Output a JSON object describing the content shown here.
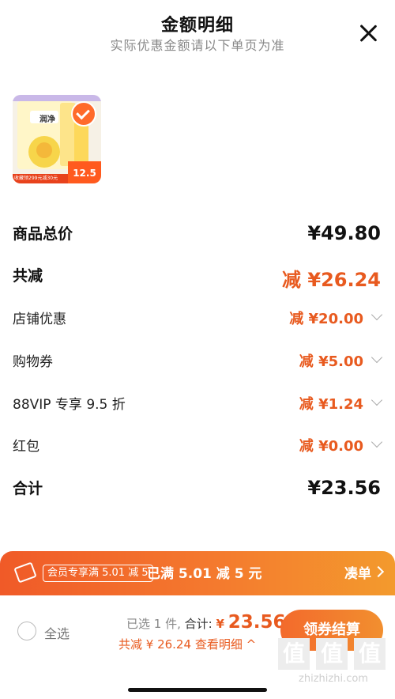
{
  "header": {
    "title": "金额明细",
    "subtitle": "实际优惠金额请以下单页为准"
  },
  "product": {
    "brand_text": "润净",
    "promo_line": "收藏领299元减30元",
    "price": "12.5"
  },
  "rows": [
    {
      "label": "商品总价",
      "value": "¥49.80"
    },
    {
      "label": "共减",
      "value": "减 ¥26.24"
    },
    {
      "label": "店铺优惠",
      "value": "减 ¥20.00"
    },
    {
      "label": "购物券",
      "value": "减 ¥5.00"
    },
    {
      "label": "88VIP 专享 9.5 折",
      "value": "减 ¥1.24"
    },
    {
      "label": "红包",
      "value": "减 ¥0.00"
    },
    {
      "label": "合计",
      "value": "¥23.56"
    }
  ],
  "promo": {
    "badge": "会员专享满 5.01 减 5",
    "message": "已满 5.01 减 5 元",
    "action": "凑单"
  },
  "footer": {
    "select_all": "全选",
    "selected": "已选 1 件,",
    "total_label": "合计:",
    "currency": "¥",
    "total": "23.56",
    "discount_line": "共减 ¥ 26.24",
    "detail_link": "查看明细 ^",
    "checkout": "领券结算"
  },
  "watermark": {
    "text": "zhizhizhi.com"
  },
  "colors": {
    "accent": "#e85a1f",
    "promo_start": "#f05a28",
    "promo_end": "#f39a2d"
  }
}
